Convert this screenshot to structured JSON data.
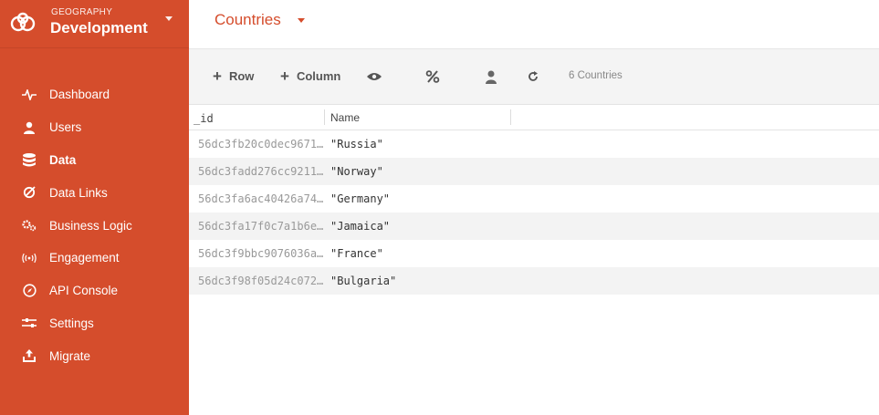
{
  "app": {
    "subtitle": "GEOGRAPHY",
    "name": "Development"
  },
  "sidebar": {
    "items": [
      {
        "label": "Dashboard",
        "icon": "pulse-icon",
        "active": false
      },
      {
        "label": "Users",
        "icon": "user-icon",
        "active": false
      },
      {
        "label": "Data",
        "icon": "database-icon",
        "active": true
      },
      {
        "label": "Data Links",
        "icon": "link-icon",
        "active": false
      },
      {
        "label": "Business Logic",
        "icon": "gears-icon",
        "active": false
      },
      {
        "label": "Engagement",
        "icon": "broadcast-icon",
        "active": false
      },
      {
        "label": "API Console",
        "icon": "compass-icon",
        "active": false
      },
      {
        "label": "Settings",
        "icon": "sliders-icon",
        "active": false
      },
      {
        "label": "Migrate",
        "icon": "upload-icon",
        "active": false
      }
    ]
  },
  "header": {
    "table_title": "Countries"
  },
  "toolbar": {
    "add_row_label": "Row",
    "add_column_label": "Column",
    "count_label": "6 Countries"
  },
  "table": {
    "columns": [
      "_id",
      "Name"
    ],
    "rows": [
      {
        "id": "56dc3fb20c0dec9671…",
        "name": "\"Russia\""
      },
      {
        "id": "56dc3fadd276cc9211…",
        "name": "\"Norway\""
      },
      {
        "id": "56dc3fa6ac40426a74…",
        "name": "\"Germany\""
      },
      {
        "id": "56dc3fa17f0c7a1b6e…",
        "name": "\"Jamaica\""
      },
      {
        "id": "56dc3f9bbc9076036a…",
        "name": "\"France\""
      },
      {
        "id": "56dc3f98f05d24c072…",
        "name": "\"Bulgaria\""
      }
    ]
  },
  "colors": {
    "brand": "#d54d2c",
    "toolbar_bg": "#f4f4f4"
  }
}
